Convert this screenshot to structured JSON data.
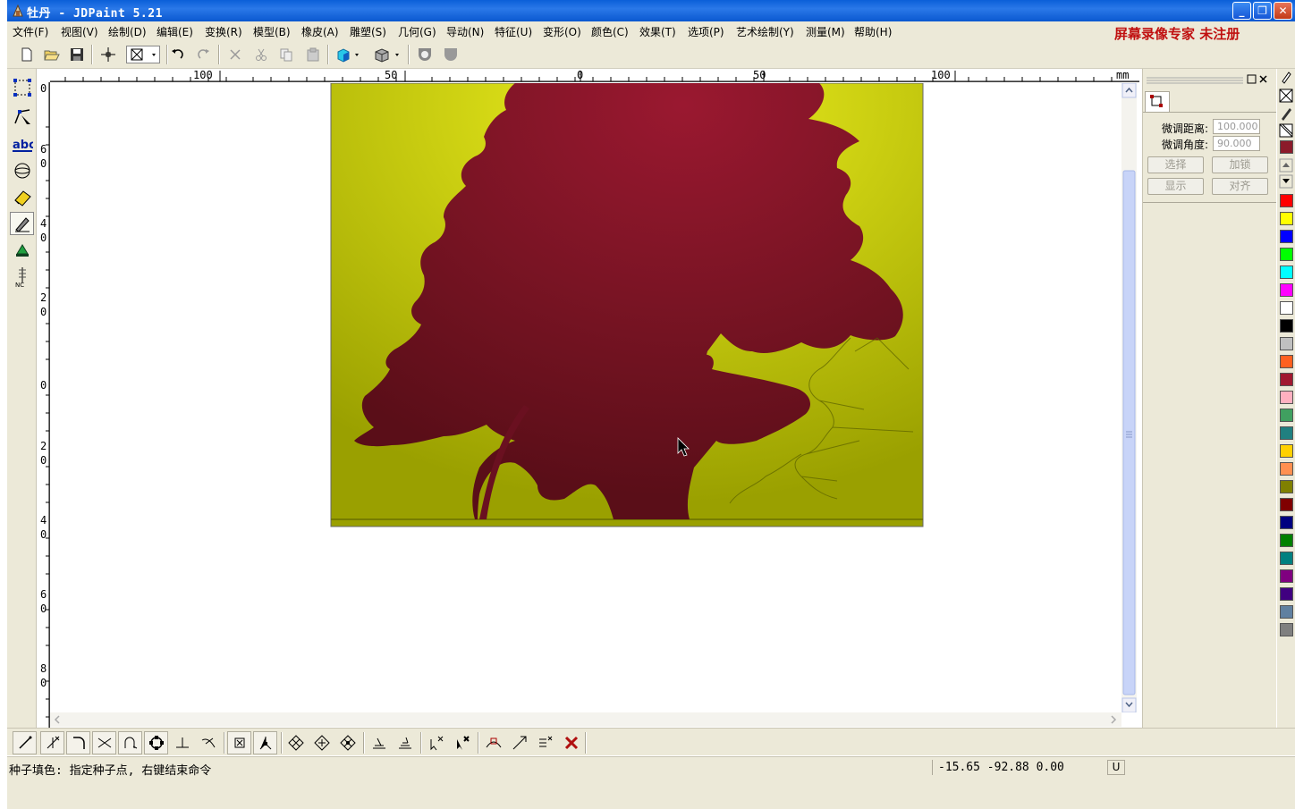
{
  "window": {
    "title": "牡丹 - JDPaint 5.21",
    "app_icon": "jdpaint-icon",
    "controls": [
      "minimize",
      "restore",
      "close"
    ]
  },
  "menu": {
    "items": [
      "文件(F)",
      "视图(V)",
      "绘制(D)",
      "编辑(E)",
      "变换(R)",
      "模型(B)",
      "橡皮(A)",
      "雕塑(S)",
      "几何(G)",
      "导动(N)",
      "特征(U)",
      "变形(O)",
      "颜色(C)",
      "效果(T)",
      "选项(P)",
      "艺术绘制(Y)",
      "测量(M)",
      "帮助(H)"
    ],
    "promo": "屏幕录像专家  未注册"
  },
  "toolbar": {
    "icons": [
      "new-file-icon",
      "open-folder-icon",
      "save-icon",
      "snap-crosshair-icon",
      "view-select-icon",
      "undo-icon",
      "redo-icon",
      "delete-icon",
      "cut-icon",
      "copy-icon",
      "paste-icon",
      "render-cube-icon",
      "view-cube-icon",
      "shield-outline-icon",
      "shield-filled-icon"
    ]
  },
  "left_tools": {
    "icons": [
      "select-box-icon",
      "node-edit-icon",
      "text-abc-icon",
      "circle-target-icon",
      "eraser-icon",
      "pen-icon",
      "fill-bucket-icon",
      "nc-path-icon"
    ]
  },
  "rulers": {
    "unit": "mm",
    "h_labels": [
      "100",
      "50",
      "0",
      "50",
      "100"
    ],
    "v_labels": [
      "0",
      "6\n0",
      "4\n0",
      "2\n0",
      "0",
      "2\n0",
      "4\n0",
      "6\n0",
      "8\n0"
    ]
  },
  "panel": {
    "fine_distance_label": "微调距离:",
    "fine_distance_value": "100.000",
    "fine_angle_label": "微调角度:",
    "fine_angle_value": "90.000",
    "select_button": "选择",
    "lock_button": "加锁",
    "show_button": "显示",
    "align_button": "对齐"
  },
  "palette": {
    "colors": [
      "#8b1a2a",
      "#ff0000",
      "#ffff00",
      "#0000ff",
      "#00ff00",
      "#00ffff",
      "#ff00ff",
      "#ffffff",
      "#000000",
      "#c0c0c0",
      "#ff6020",
      "#a01830",
      "#ffb0c0",
      "#40a060",
      "#208080",
      "#ffd000",
      "#ff9050",
      "#808000",
      "#800000",
      "#000080",
      "#008000",
      "#008080",
      "#800080",
      "#400080",
      "#6080a0",
      "#808080"
    ]
  },
  "bottom_tools": {
    "icons": [
      "line-icon",
      "trim-icon",
      "fillet-icon",
      "intersect-icon",
      "offset-curve-icon",
      "circle-node-icon",
      "perpendicular-icon",
      "tangent-icon",
      "point-x-icon",
      "axis-icon",
      "diamond-node-1-icon",
      "diamond-node-2-icon",
      "diamond-node-3-icon",
      "baseline-1-icon",
      "baseline-2-icon",
      "cursor-x-icon",
      "cursor-x-bold-icon",
      "link-node-icon",
      "join-icon",
      "list-x-icon",
      "red-x-icon"
    ]
  },
  "status": {
    "message": "种子填色: 指定种子点, 右键结束命令",
    "coords": "-15.65 -92.88 0.00",
    "mode": "U"
  },
  "image": {
    "description_colors": {
      "background": "#b5c010",
      "flower": "#7e1422"
    }
  }
}
